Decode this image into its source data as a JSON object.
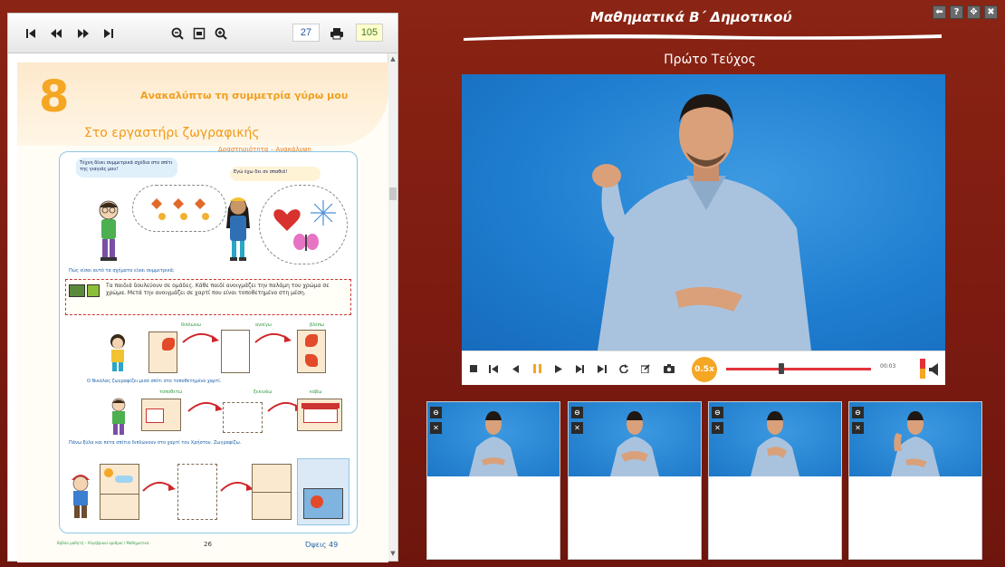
{
  "colors": {
    "background": "#7a1a10",
    "accent_orange": "#f5a623",
    "progress_red": "#e4323a",
    "video_blue": "#1f7ed0"
  },
  "window_controls": [
    {
      "icon": "back-arrow-icon",
      "glyph": "⬅"
    },
    {
      "icon": "help-icon",
      "glyph": "?"
    },
    {
      "icon": "move-icon",
      "glyph": "✥"
    },
    {
      "icon": "close-icon",
      "glyph": "✖"
    }
  ],
  "app": {
    "title": "Μαθηματικά Β΄ Δημοτικού",
    "volume": "Πρώτο Τεύχος"
  },
  "book_toolbar": {
    "current_page": "27",
    "total_pages": "105"
  },
  "book_page": {
    "chapter_number": "8",
    "chapter_title": "Ανακαλύπτω τη συμμετρία γύρω μου",
    "lesson_title": "Στο εργαστήρι ζωγραφικής",
    "activity_label": "Δραστηριότητα – Ανακάλυψη",
    "bubble_left": "Τέχνη δίνει συμμετρικά σχέδια στο σπίτι της γιαγιάς μου!",
    "bubble_right": "Εγώ έχω δει σε σπαθιά!",
    "question": "Πώς είσαι αυτό τα σχήματα είναι συμμετρικά;",
    "instruction_box": "Τα παιδιά δουλεύουν σε ομάδες. Κάθε παιδί ανοιγμάζει την παλάμη του χρώμα σε χρώμα. Μετά την ανοιγμάζει σε χαρτί που είναι τοποθετημένο στη μέση.",
    "note_1": "Ο Νικόλας ζωγραφίζει μισό σπίτι στο τοποθετημένο χαρτί.",
    "note_2": "Πάνω ξύλα και πέτα σπίτια διπλώνουν στο χαρτί του Χρήστου. Ζωγραφίζω.",
    "step_labels": [
      "διπλώνω",
      "ανοίγω",
      "βλέπω",
      "τοποθετώ",
      "ξεκινάω",
      "κόβω"
    ],
    "footer_note": "Βιβλίο μαθητή – Αλγεβρικοί αριθμοί / Μαθηματικά",
    "page_number": "26",
    "page_ref": "Όψεις 49"
  },
  "player": {
    "speed": "0.5x",
    "time": "00:03",
    "progress": 0.38,
    "volume": 0.5
  },
  "thumbnails": [
    {
      "id": "1"
    },
    {
      "id": "2"
    },
    {
      "id": "3"
    },
    {
      "id": "4"
    }
  ]
}
